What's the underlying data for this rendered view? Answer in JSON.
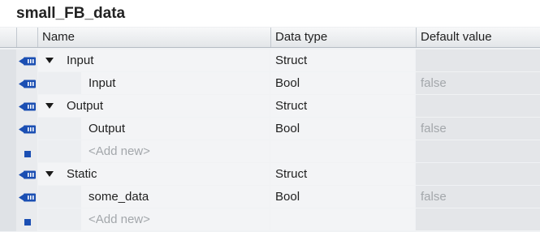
{
  "title": "small_FB_data",
  "columns": {
    "name": "Name",
    "data_type": "Data type",
    "default_value": "Default value"
  },
  "rows": [
    {
      "name": "Input",
      "type": "Struct",
      "default": "",
      "level": 0,
      "expandable": true,
      "icon": "input-param-icon"
    },
    {
      "name": "Input",
      "type": "Bool",
      "default": "false",
      "level": 1,
      "expandable": false,
      "icon": "input-param-icon"
    },
    {
      "name": "Output",
      "type": "Struct",
      "default": "",
      "level": 0,
      "expandable": true,
      "icon": "output-param-icon"
    },
    {
      "name": "Output",
      "type": "Bool",
      "default": "false",
      "level": 1,
      "expandable": false,
      "icon": "output-param-icon"
    },
    {
      "name": "<Add new>",
      "type": "",
      "default": "",
      "level": 1,
      "expandable": false,
      "icon": "add-new-icon",
      "placeholder": true
    },
    {
      "name": "Static",
      "type": "Struct",
      "default": "",
      "level": 0,
      "expandable": true,
      "icon": "static-param-icon"
    },
    {
      "name": "some_data",
      "type": "Bool",
      "default": "false",
      "level": 1,
      "expandable": false,
      "icon": "static-param-icon"
    },
    {
      "name": "<Add new>",
      "type": "",
      "default": "",
      "level": 1,
      "expandable": false,
      "icon": "add-new-icon",
      "placeholder": true
    }
  ],
  "colors": {
    "icon_blue": "#1b4fb3",
    "muted_text": "#a3a7ab"
  }
}
